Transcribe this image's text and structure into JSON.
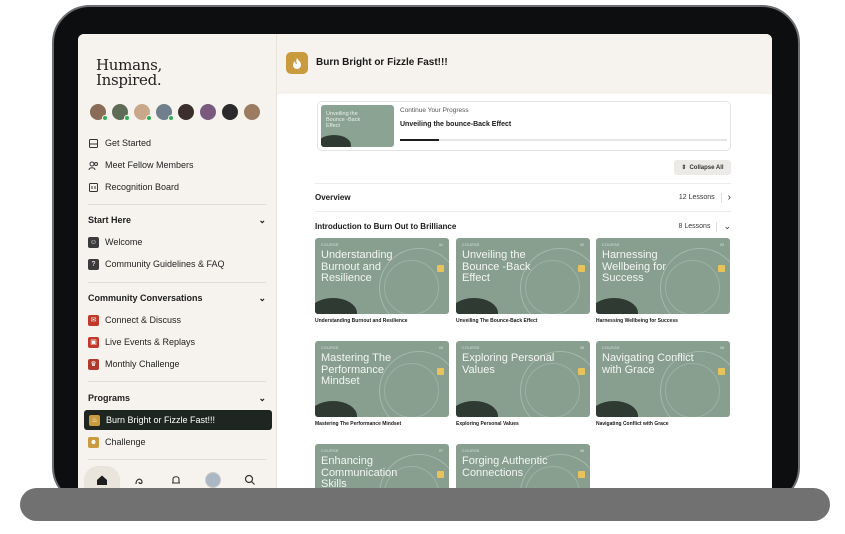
{
  "sidebar": {
    "logo_line1": "Humans,",
    "logo_line2": "Inspired.",
    "avatar_colors": [
      "#8a6b55",
      "#5d6b57",
      "#c9a88a",
      "#6f7f8c",
      "#3a2f2a",
      "#7a5a7c",
      "#2b2b2b",
      "#9c7b63"
    ],
    "top_items": [
      {
        "label": "Get Started",
        "icon": "inbox-icon"
      },
      {
        "label": "Meet Fellow Members",
        "icon": "members-icon"
      },
      {
        "label": "Recognition Board",
        "icon": "board-icon"
      }
    ],
    "sections": [
      {
        "title": "Start Here",
        "items": [
          {
            "label": "Welcome",
            "icon": "welcome-icon",
            "color": "#3b3b3b"
          },
          {
            "label": "Community Guidelines & FAQ",
            "icon": "guidelines-icon",
            "color": "#3b3b3b"
          }
        ]
      },
      {
        "title": "Community Conversations",
        "items": [
          {
            "label": "Connect & Discuss",
            "icon": "discuss-icon",
            "color": "#c0392b"
          },
          {
            "label": "Live Events & Replays",
            "icon": "events-icon",
            "color": "#c0392b"
          },
          {
            "label": "Monthly Challenge",
            "icon": "trophy-icon",
            "color": "#b03a2e"
          }
        ]
      },
      {
        "title": "Programs",
        "items": [
          {
            "label": "Burn Bright or Fizzle Fast!!!",
            "icon": "flame-icon",
            "color": "#c99a3e"
          },
          {
            "label": "Challenge",
            "icon": "challenge-icon",
            "color": "#c99a3e"
          }
        ]
      }
    ],
    "bottom_nav": [
      "home-icon",
      "activity-icon",
      "bell-icon",
      "profile-avatar",
      "search-icon"
    ]
  },
  "main": {
    "title": "Burn Bright or Fizzle Fast!!!",
    "continue": {
      "label": "Continue Your Progress",
      "title": "Unveiling the bounce-Back Effect",
      "thumb_text": "Unveiling the Bounce -Back Effect",
      "progress": 0.12
    },
    "collapse_label": "Collapse All",
    "overview": {
      "title": "Overview",
      "count": "12 Lessons"
    },
    "module": {
      "title": "Introduction to Burn Out to Brilliance",
      "count": "8 Lessons"
    },
    "courses": [
      {
        "kicker": "COURSE",
        "num": "01",
        "thumb": "Understanding Burnout and Resilience",
        "caption": "Understanding Burnout and Resilience"
      },
      {
        "kicker": "COURSE",
        "num": "02",
        "thumb": "Unveiling the Bounce -Back Effect",
        "caption": "Unveiling The Bounce-Back Effect"
      },
      {
        "kicker": "COURSE",
        "num": "03",
        "thumb": "Harnessing Wellbeing for Success",
        "caption": "Harnessing Wellbeing for Success"
      },
      {
        "kicker": "COURSE",
        "num": "04",
        "thumb": "Mastering The Performance Mindset",
        "caption": "Mastering The Performance Mindset"
      },
      {
        "kicker": "COURSE",
        "num": "05",
        "thumb": "Exploring Personal Values",
        "caption": "Exploring Personal Values"
      },
      {
        "kicker": "COURSE",
        "num": "06",
        "thumb": "Navigating Conflict with Grace",
        "caption": "Navigating Conflict with Grace"
      },
      {
        "kicker": "COURSE",
        "num": "07",
        "thumb": "Enhancing Communication Skills",
        "caption": ""
      },
      {
        "kicker": "COURSE",
        "num": "08",
        "thumb": "Forging Authentic Connections",
        "caption": ""
      }
    ]
  }
}
